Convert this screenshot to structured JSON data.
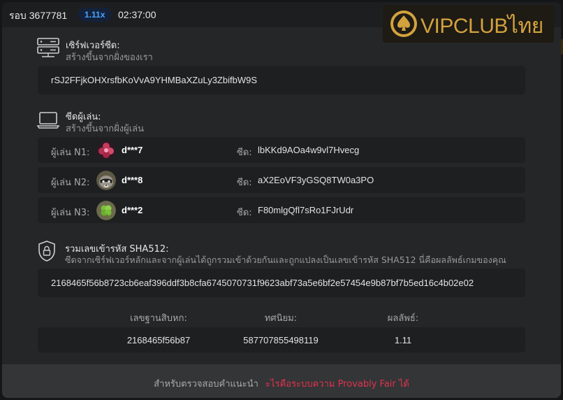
{
  "header": {
    "round_label": "รอบ 3677781",
    "multiplier": "1.11x",
    "time": "02:37:00"
  },
  "logo": {
    "text": "VIPCLUBไทย",
    "icon": "spade-chip-icon",
    "color": "#d2a23e"
  },
  "server_seed": {
    "icon": "server-icon",
    "title": "เซิร์ฟเวอร์ซีด:",
    "subtitle": "สร้างขึ้นจากฝั่งของเรา",
    "value": "rSJ2FFjkOHXrsfbKoVvA9YHMBaXZuLy3ZbifbW9S"
  },
  "client_seed": {
    "icon": "laptop-icon",
    "title": "ซีดผู้เล่น:",
    "subtitle": "สร้างขึ้นจากฝั่งผู้เล่น",
    "seed_label": "ซีด:",
    "players": [
      {
        "label": "ผู้เล่น N1:",
        "name": "d***7",
        "seed": "lbKKd9AOa4w9vl7Hvecg",
        "avatar": "flower-avatar-icon"
      },
      {
        "label": "ผู้เล่น N2:",
        "name": "d***8",
        "seed": "aX2EoVF3yGSQ8TW0a3PO",
        "avatar": "raccoon-avatar-icon"
      },
      {
        "label": "ผู้เล่น N3:",
        "name": "d***2",
        "seed": "F80mlgQfl7sRo1FJrUdr",
        "avatar": "clover-avatar-icon"
      }
    ]
  },
  "sha512": {
    "icon": "shield-lock-icon",
    "title": "รวมเลขเข้ารหัส SHA512:",
    "subtitle": "ซีดจากเซิร์ฟเวอร์หลักและจากผู้เล่นได้ถูกรวมเข้าด้วยกันและถูกแปลงเป็นเลขเข้ารหัส SHA512 นี่คือผลลัพธ์เกมของคุณ",
    "value": "2168465f56b8723cb6eaf396ddf3b8cfa6745070731f9623abf73a5e6bf2e57454e9b87bf7b5ed16c4b02e02"
  },
  "result": {
    "hex_label": "เลขฐานสิบหก:",
    "decimal_label": "ทศนิยม:",
    "result_label": "ผลลัพธ์:",
    "hex_value": "2168465f56b87",
    "decimal_value": "587707855498119",
    "result_value": "1.11"
  },
  "footer": {
    "text": "สำหรับตรวจสอบคำแนะนำ",
    "link": "ะไรคือระบบความ Provably Fair ได้",
    "link_color": "#e0334d"
  }
}
